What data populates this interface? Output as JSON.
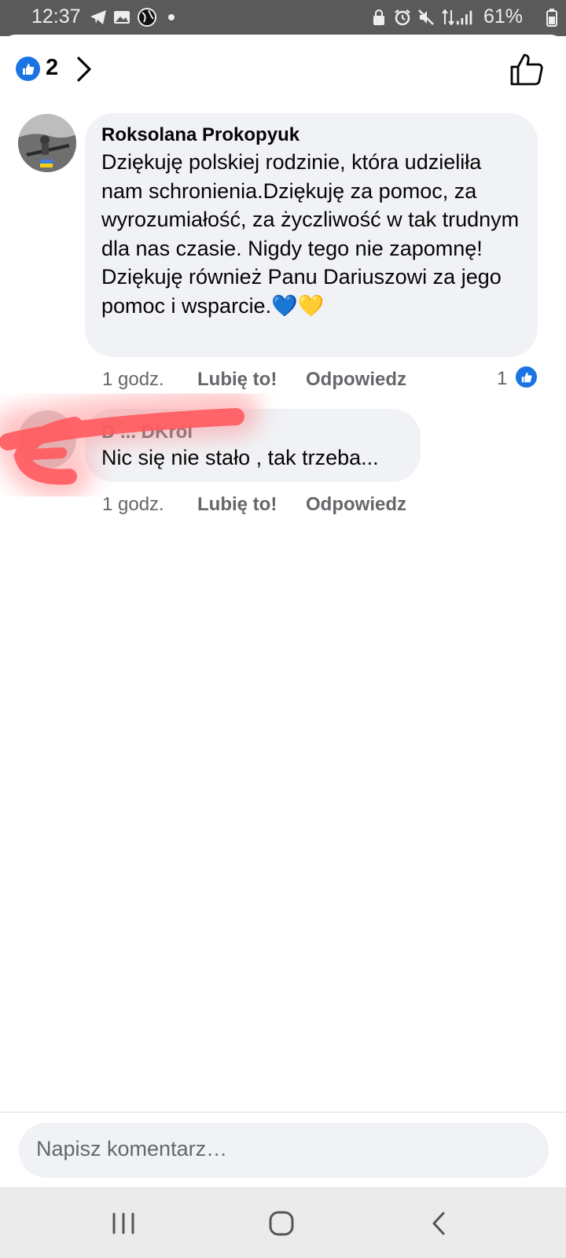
{
  "status_bar": {
    "time": "12:37",
    "battery": "61%",
    "icons": [
      "telegram-icon",
      "gallery-icon",
      "globe-icon",
      "dot-icon",
      "lock-icon",
      "alarm-icon",
      "mute-icon",
      "data-icon",
      "signal-icon",
      "battery-icon"
    ]
  },
  "header": {
    "reaction_count": "2"
  },
  "comments": [
    {
      "author": "Roksolana Prokopyuk",
      "text": "Dziękuję polskiej rodzinie, która udzieliła nam schronienia.Dziękuję za pomoc, za wyrozumiałość, za życzliwość w tak trudnym dla nas czasie. Nigdy tego nie zapomnę! Dziękuję również Panu Dariuszowi za jego pomoc i wsparcie.💙💛",
      "time": "1 godz.",
      "like_label": "Lubię to!",
      "reply_label": "Odpowiedz",
      "reactions": "1"
    },
    {
      "author": "D  ...  DKról",
      "text": "Nic się nie stało , tak trzeba...",
      "time": "1 godz.",
      "like_label": "Lubię to!",
      "reply_label": "Odpowiedz"
    }
  ],
  "composer": {
    "placeholder": "Napisz komentarz…"
  },
  "colors": {
    "accent": "#1b74e4",
    "bubble": "#f0f2f5",
    "meta": "#65676b",
    "scribble": "#ff5a5f"
  }
}
